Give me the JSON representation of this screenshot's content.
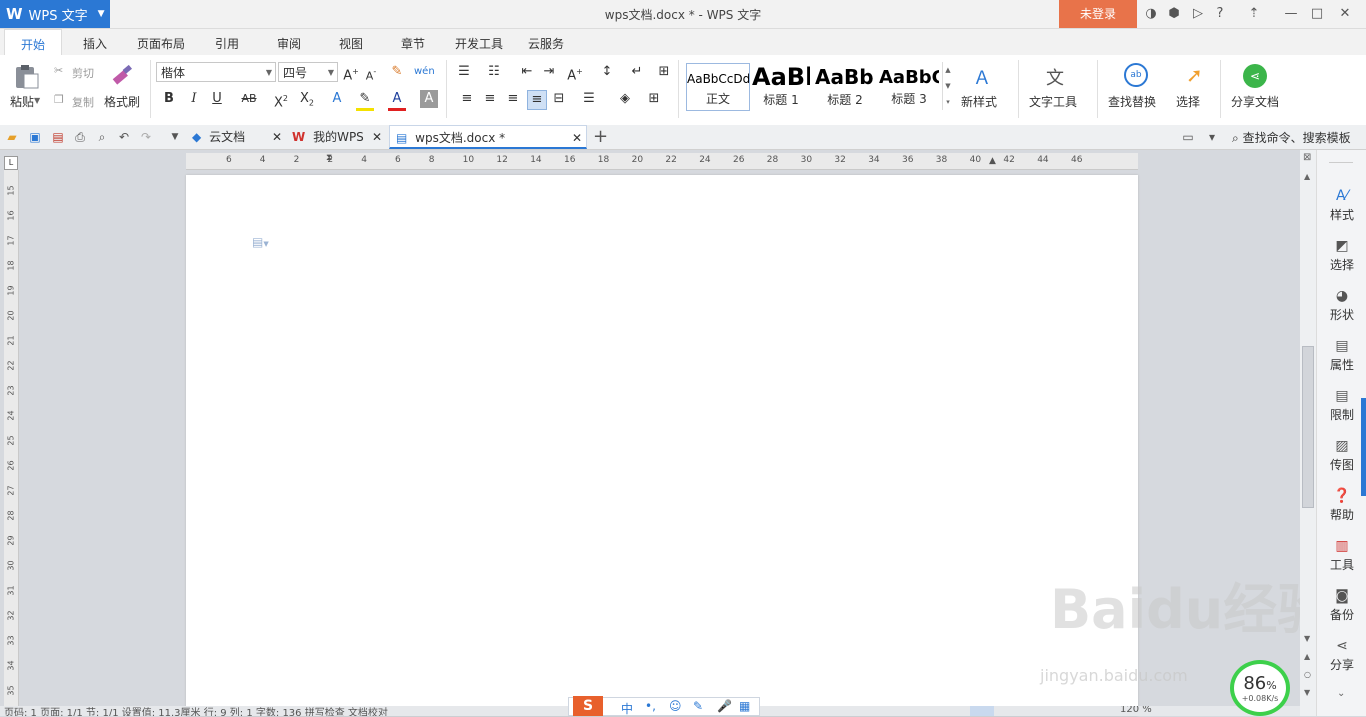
{
  "titlebar": {
    "app_logo": "W",
    "app_name": "WPS 文字",
    "doc_title": "wps文档.docx * - WPS 文字",
    "login_label": "未登录"
  },
  "menu": {
    "tabs": [
      "开始",
      "插入",
      "页面布局",
      "引用",
      "审阅",
      "视图",
      "章节",
      "开发工具",
      "云服务"
    ],
    "active": "开始"
  },
  "ribbon": {
    "paste_label": "粘贴",
    "cut_label": "剪切",
    "copy_label": "复制",
    "format_painter_label": "格式刷",
    "font_name": "楷体",
    "font_size": "四号",
    "styles": [
      {
        "sample": "AaBbCcDd",
        "name": "正文"
      },
      {
        "sample": "AaBl",
        "name": "标题 1"
      },
      {
        "sample": "AaBb(",
        "name": "标题 2"
      },
      {
        "sample": "AaBbC",
        "name": "标题 3"
      }
    ],
    "new_style_label": "新样式",
    "text_tools_label": "文字工具",
    "find_replace_label": "查找替换",
    "select_label": "选择",
    "share_label": "分享文档"
  },
  "doctabs": {
    "tabs": [
      {
        "label": "云文档"
      },
      {
        "label": "我的WPS"
      },
      {
        "label": "wps文档.docx *"
      }
    ],
    "search_label": "查找命令、搜索模板"
  },
  "ruler": {
    "h_labels": [
      "6",
      "4",
      "2",
      "2",
      "4",
      "6",
      "8",
      "10",
      "12",
      "14",
      "16",
      "18",
      "20",
      "22",
      "24",
      "26",
      "28",
      "30",
      "32",
      "34",
      "36",
      "38",
      "40",
      "42",
      "44",
      "46"
    ],
    "v_labels": [
      "15",
      "16",
      "17",
      "18",
      "19",
      "20",
      "21",
      "22",
      "23",
      "24",
      "25",
      "26",
      "27",
      "28",
      "29",
      "30",
      "31",
      "32",
      "33",
      "34",
      "35"
    ]
  },
  "sidebar": {
    "items": [
      {
        "label": "样式"
      },
      {
        "label": "选择"
      },
      {
        "label": "形状"
      },
      {
        "label": "属性"
      },
      {
        "label": "限制"
      },
      {
        "label": "传图"
      },
      {
        "label": "帮助"
      },
      {
        "label": "工具"
      },
      {
        "label": "备份"
      },
      {
        "label": "分享"
      }
    ]
  },
  "status": {
    "text": "页码: 1  页面: 1/1  节: 1/1  设置值: 11.3厘米  行: 9  列: 1  字数: 136  拼写检查  文档校对",
    "zoom": "120 %"
  },
  "ime": {
    "logo": "S",
    "mode": "中"
  },
  "watermark": {
    "main": "Baidu经验",
    "sub": "jingyan.baidu.com"
  },
  "speed": {
    "percent": "86",
    "unit": "%",
    "rate": "+0.08K/s"
  },
  "colors": {
    "accent": "#2b78d4",
    "login": "#e8734a",
    "share": "#3bb54a"
  }
}
